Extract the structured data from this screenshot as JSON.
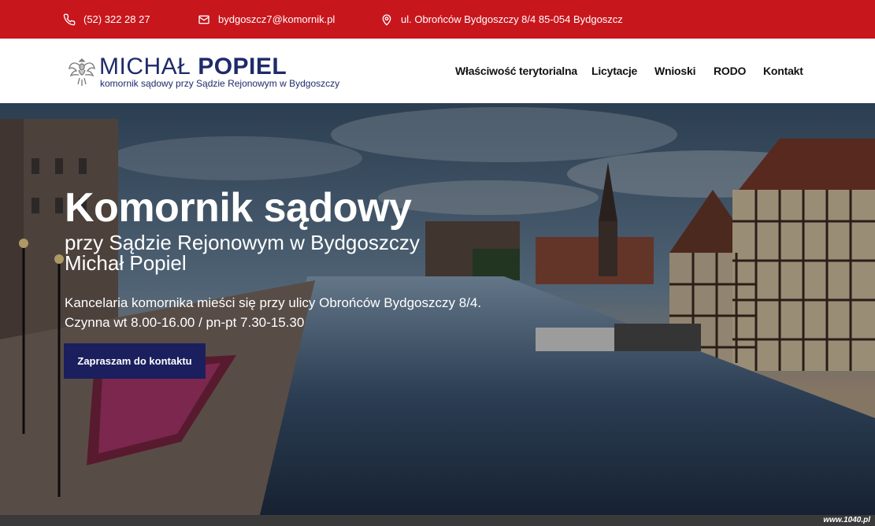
{
  "topbar": {
    "phone": "(52) 322 28 27",
    "email": "bydgoszcz7@komornik.pl",
    "address": "ul. Obrońców Bydgoszczy 8/4 85-054 Bydgoszcz",
    "background_color": "#c8161d"
  },
  "logo": {
    "first_name": "MICHAŁ ",
    "last_name": "POPIEL",
    "tagline": "komornik sądowy przy Sądzie Rejonowym w Bydgoszczy",
    "brand_color": "#1f2a6b"
  },
  "nav": {
    "items": [
      {
        "label": "Właściwość terytorialna"
      },
      {
        "label": "Licytacje"
      },
      {
        "label": "Wnioski"
      },
      {
        "label": "RODO"
      },
      {
        "label": "Kontakt"
      }
    ]
  },
  "hero": {
    "title": "Komornik sądowy",
    "subtitle_line1": "przy Sądzie Rejonowym w Bydgoszczy",
    "subtitle_line2": "Michał Popiel",
    "info_line1": "Kancelaria komornika mieści się przy ulicy Obrońców Bydgoszczy 8/4.",
    "info_line2": "Czynna wt 8.00-16.00 / pn-pt 7.30-15.30",
    "cta_label": "Zapraszam do kontaktu",
    "cta_color": "#1b1f5e"
  },
  "watermark": "www.1040.pl",
  "icons": {
    "phone": "phone-icon",
    "email": "envelope-icon",
    "address": "map-pin-icon",
    "logo": "eagle-emblem-icon"
  }
}
